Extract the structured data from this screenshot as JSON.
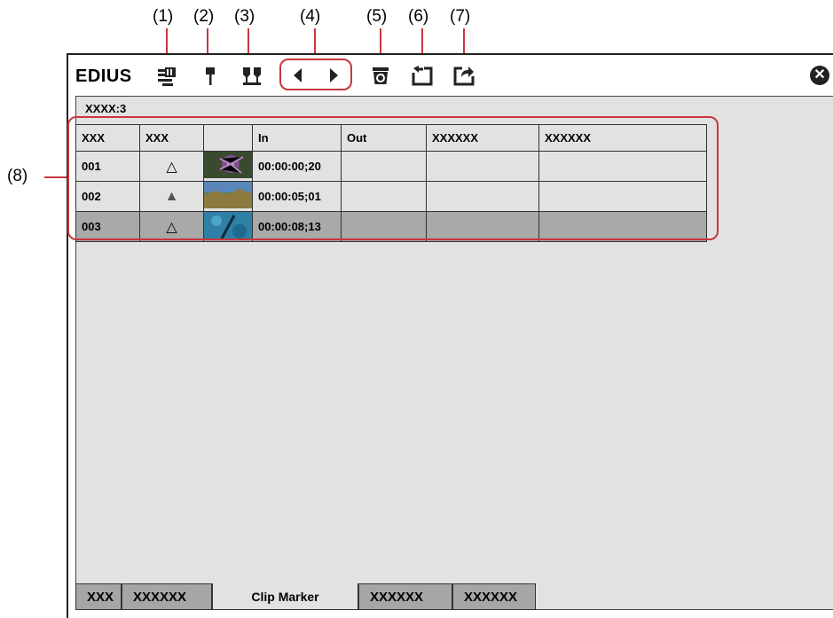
{
  "callouts": {
    "c1": "(1)",
    "c2": "(2)",
    "c3": "(3)",
    "c4": "(4)",
    "c5": "(5)",
    "c6": "(6)",
    "c7": "(7)",
    "c8": "(8)"
  },
  "app": {
    "logo": "EDIUS",
    "close_icon": "close-icon"
  },
  "toolbar": {
    "icons": [
      "marker-list-icon",
      "set-marker-icon",
      "clear-marker-icon",
      "prev-marker-icon",
      "next-marker-icon",
      "delete-marker-icon",
      "import-marker-icon",
      "export-marker-icon"
    ]
  },
  "clip": {
    "title": "XXXX:3"
  },
  "table": {
    "headers": [
      "XXX",
      "XXX",
      "",
      "In",
      "Out",
      "XXXXXX",
      "XXXXXX"
    ],
    "rows": [
      {
        "no": "001",
        "mark": "△",
        "in": "00:00:00;20",
        "out": "",
        "c5": "",
        "c6": ""
      },
      {
        "no": "002",
        "mark": "▲",
        "in": "00:00:05;01",
        "out": "",
        "c5": "",
        "c6": ""
      },
      {
        "no": "003",
        "mark": "△",
        "in": "00:00:08;13",
        "out": "",
        "c5": "",
        "c6": ""
      }
    ],
    "selected_row": 3
  },
  "tabs": [
    "XXX",
    "XXXXXX",
    "Clip Marker",
    "XXXXXX",
    "XXXXXX"
  ],
  "active_tab": "Clip Marker",
  "colors": {
    "highlight": "#c9363c",
    "panel_bg": "#e2e2e2",
    "selected_row": "#a9a9a9",
    "tab_bg": "#a6a6a6"
  }
}
